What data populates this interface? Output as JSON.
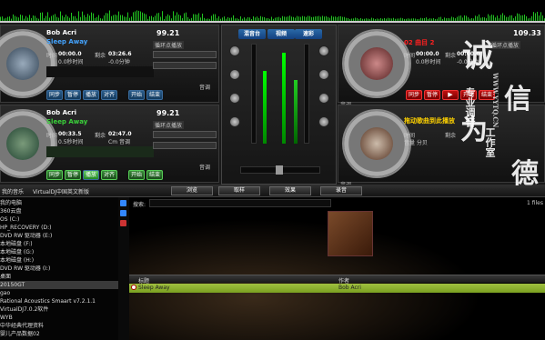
{
  "app": {
    "name": "VirtualDJ"
  },
  "colors": {
    "accent": "#2a6aa8",
    "wave": "#21c321",
    "green_title": "#3ad23a",
    "red_title": "#ff2020",
    "yellow_title": "#ffd200",
    "track_row": "#8ab030"
  },
  "deck1": {
    "artist": "Bob Acri",
    "title": "Sleep Away",
    "bpm": "99.21",
    "pitch_label": "循环点播放",
    "elapsed_label": "时间",
    "elapsed": "00:00.0",
    "elapsed_sub": "0.0秒时间",
    "remain_label": "剩余",
    "remain": "03:26.6",
    "remain_sub": "-0.0分钟",
    "buttons": [
      "同步",
      "暂停",
      "播放",
      "对齐"
    ],
    "loop_buttons": [
      "开始",
      "结束"
    ],
    "vol_label": "音调"
  },
  "deck2": {
    "artist": "Bob Acri",
    "title": "Sleep Away",
    "bpm": "99.21",
    "pitch_label": "循环点播放",
    "elapsed_label": "时间",
    "elapsed": "00:33.5",
    "elapsed_sub": "0.5秒时间",
    "remain_label": "剩余",
    "remain": "02:47.0",
    "remain_sub": "Cm 音调",
    "buttons": [
      "同步",
      "暂停",
      "播放",
      "对齐"
    ],
    "loop_buttons": [
      "开始",
      "结束"
    ],
    "vol_label": "音调"
  },
  "deck3": {
    "artist": "",
    "title": "02 曲目 2",
    "bpm": "109.33",
    "pitch_label": "循环点播放",
    "elapsed_label": "时间",
    "elapsed": "00:00.0",
    "elapsed_sub": "0.0秒时间",
    "remain_label": "剩余",
    "remain": "00:00.0",
    "remain_sub": "-0.0分钟",
    "buttons": [
      "同步",
      "暂停"
    ],
    "loop_buttons": [
      "开始",
      "结束"
    ],
    "vol_label": "音调"
  },
  "deck4": {
    "title": "拖动歌曲到此播放",
    "elapsed_label": "时间",
    "elapsed_sub": "音量 分贝",
    "remain_label": "剩余",
    "vol_label": "音调"
  },
  "mixer": {
    "tabs": [
      "混音台",
      "视频",
      "速彩"
    ]
  },
  "midbar": {
    "left_text": "我的音乐",
    "path_text": "VirtualDJ中国英文新版",
    "tabs": [
      "浏览",
      "取样",
      "效果",
      "录音"
    ]
  },
  "browser": {
    "search_label": "搜索:",
    "file_count": "1 files",
    "columns": {
      "title": "标题",
      "artist": "作者"
    },
    "tracks": [
      {
        "title": "Sleep Away",
        "artist": "Bob Acri"
      }
    ],
    "tree": [
      "我的电脑",
      "360云盘",
      "OS (C:)",
      "HP_RECOVERY (D:)",
      "DVD RW 驱动器 (E:)",
      "本地磁盘 (F:)",
      "本地磁盘 (G:)",
      "本地磁盘 (H:)",
      "DVD RW 驱动器 (I:)",
      "桌面",
      "20150GT",
      "gao",
      "Rational Acoustics Smaart v7.2.1.1",
      "VirtualDJ7.0.2软件",
      "WYB",
      "中华经典代理资料",
      "婴儿产品数据02"
    ]
  },
  "watermark": {
    "big1": "诚",
    "big2": "信",
    "big3": "为",
    "big4": "德",
    "small": "专业调音",
    "sub": "工作室",
    "url": "WWW.YYTQ.CN"
  }
}
